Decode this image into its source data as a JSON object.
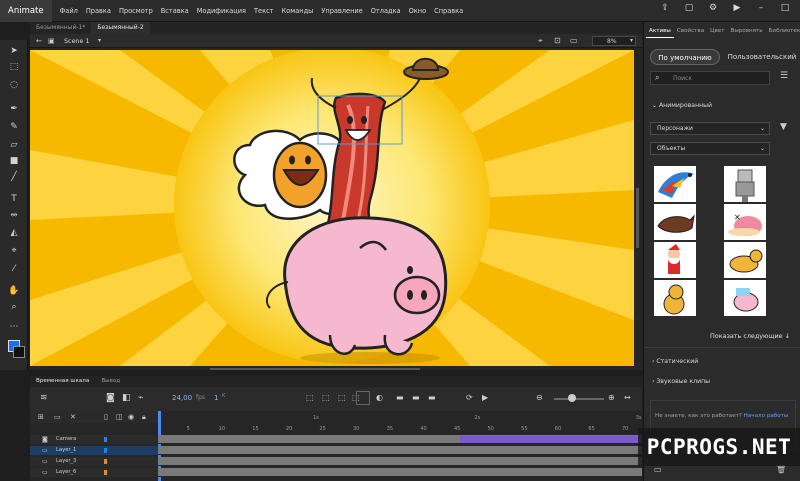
{
  "app": {
    "name": "Animate"
  },
  "menu": [
    "Файл",
    "Правка",
    "Просмотр",
    "Вставка",
    "Модификация",
    "Текст",
    "Команды",
    "Управление",
    "Отладка",
    "Окно",
    "Справка"
  ],
  "doc_tabs": [
    {
      "label": "Безымянный-1*",
      "active": false
    },
    {
      "label": "Безымянный-2",
      "active": true
    }
  ],
  "scene": {
    "name": "Scene 1",
    "zoom": "8%"
  },
  "timeline": {
    "tabs": [
      "Временная шкала",
      "Вывод"
    ],
    "fps": "24,00",
    "fps_unit": "fps",
    "frame": "1",
    "frame_unit": "K",
    "ruler": [
      "5",
      "10",
      "15",
      "20",
      "25",
      "30",
      "35",
      "40",
      "45",
      "50",
      "55",
      "60",
      "65",
      "70"
    ],
    "seconds": [
      "1s",
      "2s",
      "3s"
    ],
    "layers": [
      "Camera",
      "Layer_1",
      "Layer_3",
      "Layer_6"
    ]
  },
  "panel": {
    "tabs": [
      "Активы",
      "Свойства",
      "Цвет",
      "Выровнять",
      "Библиотека"
    ],
    "default_button": "По умолчанию",
    "custom_button": "Пользовательский",
    "search_placeholder": "Поиск",
    "section_animated": "Анимированный",
    "dropdown_characters": "Персонажи",
    "dropdown_objects": "Объекты",
    "show_next": "Показать следующие",
    "section_static": "Статический",
    "section_sound": "Звуковые клипы",
    "help_text": "Не знаете, как это работает?",
    "help_link": "Начало работы"
  },
  "watermark": "PCPROGS.NET",
  "colors": {
    "accent": "#1473e6",
    "stage_yellow": "#f9c513",
    "timeline_purple": "#7b5cc7",
    "pig_pink": "#f5b8cf"
  }
}
